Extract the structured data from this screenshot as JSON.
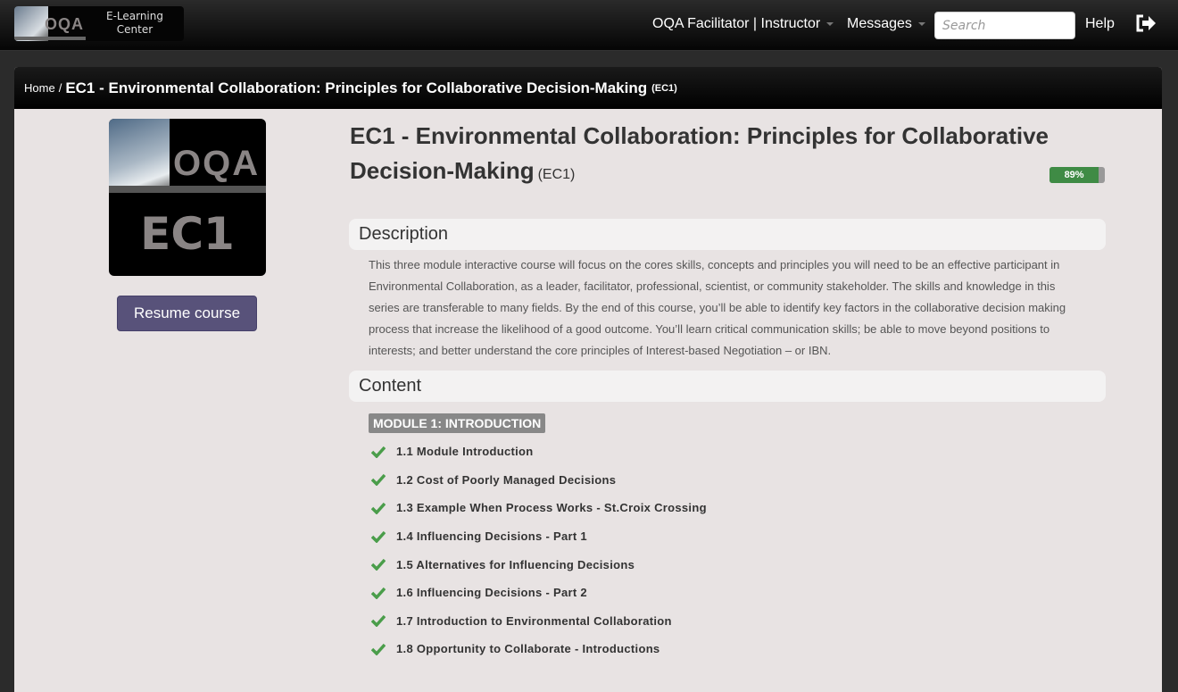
{
  "header": {
    "logo_text": "E-Learning Center",
    "logo_mark": "OQA",
    "user_menu": "OQA Facilitator | Instructor",
    "messages": "Messages",
    "search_placeholder": "Search",
    "help": "Help",
    "logout_icon": "sign-out-icon"
  },
  "breadcrumb": {
    "home": "Home",
    "separator": "/",
    "title": "EC1 - Environmental Collaboration: Principles for Collaborative Decision-Making",
    "code": "(EC1)"
  },
  "course": {
    "thumbnail_code": "EC1",
    "thumbnail_mark": "OQA",
    "resume_label": "Resume course",
    "title": "EC1 - Environmental Collaboration: Principles for Collaborative Decision-Making",
    "code": "(EC1)",
    "progress_percent": 89,
    "progress_label": "89%"
  },
  "description": {
    "heading": "Description",
    "text": "This three module interactive course will focus on the cores skills, concepts and principles you will need to be an effective participant in Environmental Collaboration, as a leader, facilitator, professional, scientist, or community stakeholder. The skills and knowledge in this series are transferable to many fields. By the end of this course, you’ll be able to identify key factors in the collaborative decision making process that increase the likelihood of a good outcome. You’ll learn critical communication skills; be able to move beyond positions to interests; and better understand the core principles of Interest-based Negotiation – or IBN."
  },
  "content": {
    "heading": "Content",
    "modules": [
      {
        "title": "MODULE 1: INTRODUCTION",
        "items": [
          {
            "label": "1.1 Module Introduction",
            "completed": true
          },
          {
            "label": "1.2 Cost of Poorly Managed Decisions",
            "completed": true
          },
          {
            "label": "1.3 Example When Process Works - St.Croix Crossing",
            "completed": true
          },
          {
            "label": "1.4 Influencing Decisions - Part 1",
            "completed": true
          },
          {
            "label": "1.5 Alternatives for Influencing Decisions",
            "completed": true
          },
          {
            "label": "1.6 Influencing Decisions - Part 2",
            "completed": true
          },
          {
            "label": "1.7 Introduction to Environmental Collaboration",
            "completed": true
          },
          {
            "label": "1.8 Opportunity to Collaborate - Introductions",
            "completed": true
          }
        ]
      }
    ]
  },
  "colors": {
    "accent": "#58527a",
    "progress": "#3f8b45",
    "check": "#4a9d4a"
  }
}
